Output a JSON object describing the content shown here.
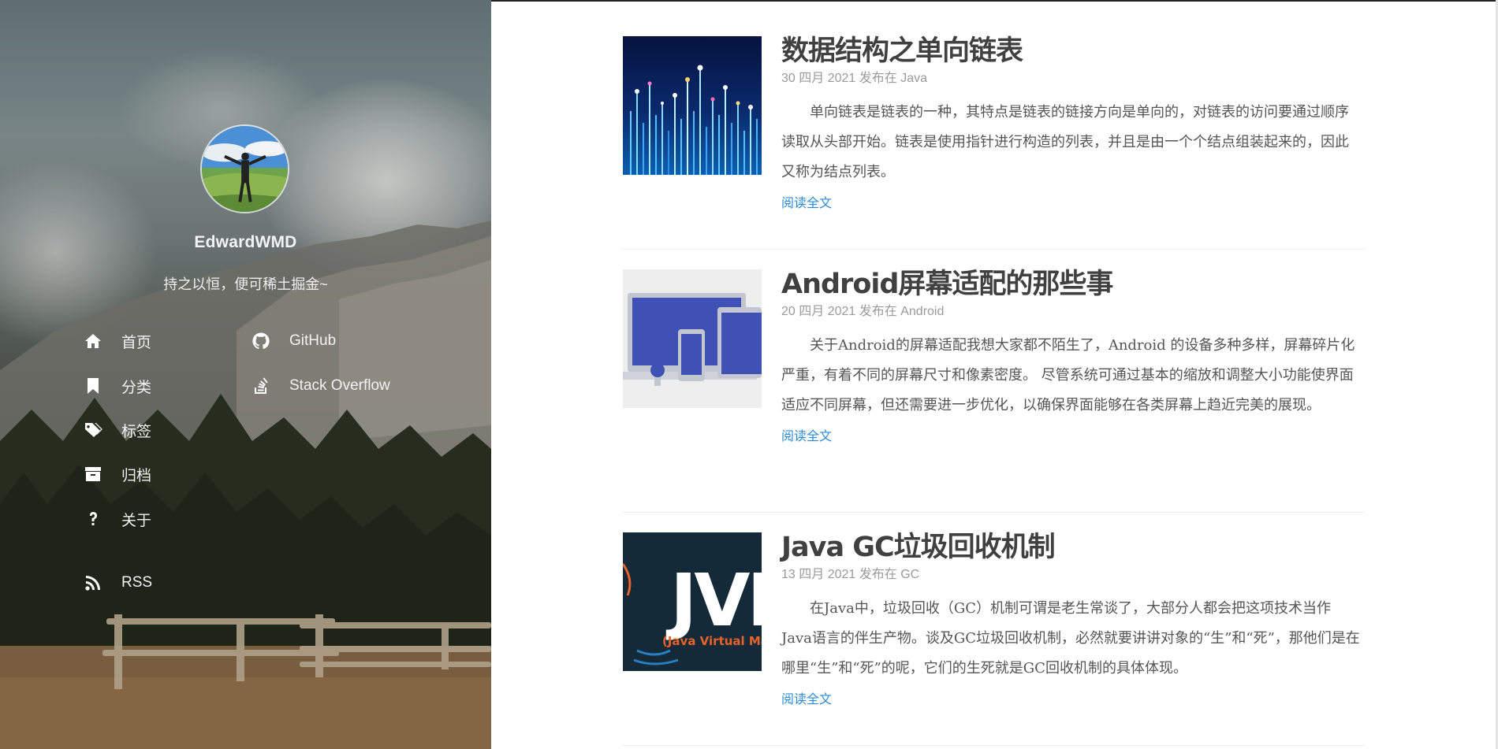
{
  "site": {
    "name": "EdwardWMD",
    "motto": "持之以恒，便可稀土掘金~"
  },
  "nav": {
    "home": {
      "label": "首页",
      "icon": "home-icon"
    },
    "categories": {
      "label": "分类",
      "icon": "bookmark-icon"
    },
    "tags": {
      "label": "标签",
      "icon": "tags-icon"
    },
    "archives": {
      "label": "归档",
      "icon": "archive-icon"
    },
    "about": {
      "label": "关于",
      "icon": "question-icon"
    },
    "rss": {
      "label": "RSS",
      "icon": "rss-icon"
    },
    "github": {
      "label": "GitHub",
      "icon": "github-icon"
    },
    "stackoverflow": {
      "label": "Stack Overflow",
      "icon": "stack-overflow-icon"
    }
  },
  "posts": [
    {
      "title": "数据结构之单向链表",
      "date": "30 四月 2021",
      "meta_prefix": "发布在",
      "category": "Java",
      "excerpt": "单向链表是链表的一种，其特点是链表的链接方向是单向的，对链表的访问要通过顺序读取从头部开始。链表是使用指针进行构造的列表，并且是由一个个结点组装起来的，因此又称为结点列表。",
      "read_more": "阅读全文"
    },
    {
      "title": "Android屏幕适配的那些事",
      "date": "20 四月 2021",
      "meta_prefix": "发布在",
      "category": "Android",
      "excerpt": "关于Android的屏幕适配我想大家都不陌生了，Android 的设备多种多样，屏幕碎片化严重，有着不同的屏幕尺寸和像素密度。 尽管系统可通过基本的缩放和调整大小功能使界面适应不同屏幕，但还需要进一步优化，以确保界面能够在各类屏幕上趋近完美的展现。",
      "read_more": "阅读全文"
    },
    {
      "title": "Java GC垃圾回收机制",
      "date": "13 四月 2021",
      "meta_prefix": "发布在",
      "category": "GC",
      "excerpt": "在Java中，垃圾回收（GC）机制可谓是老生常谈了，大部分人都会把这项技术当作Java语言的伴生产物。谈及GC垃圾回收机制，必然就要讲讲对象的“生”和“死”，那他们是在哪里“生”和“死”的呢，它们的生死就是GC回收机制的具体体现。",
      "read_more": "阅读全文",
      "thumb_text": "JVM",
      "thumb_subtext": "(Java Virtual Ma"
    }
  ],
  "colors": {
    "link": "#2a8bd6",
    "title": "#404040",
    "meta": "#9a9a9a"
  }
}
